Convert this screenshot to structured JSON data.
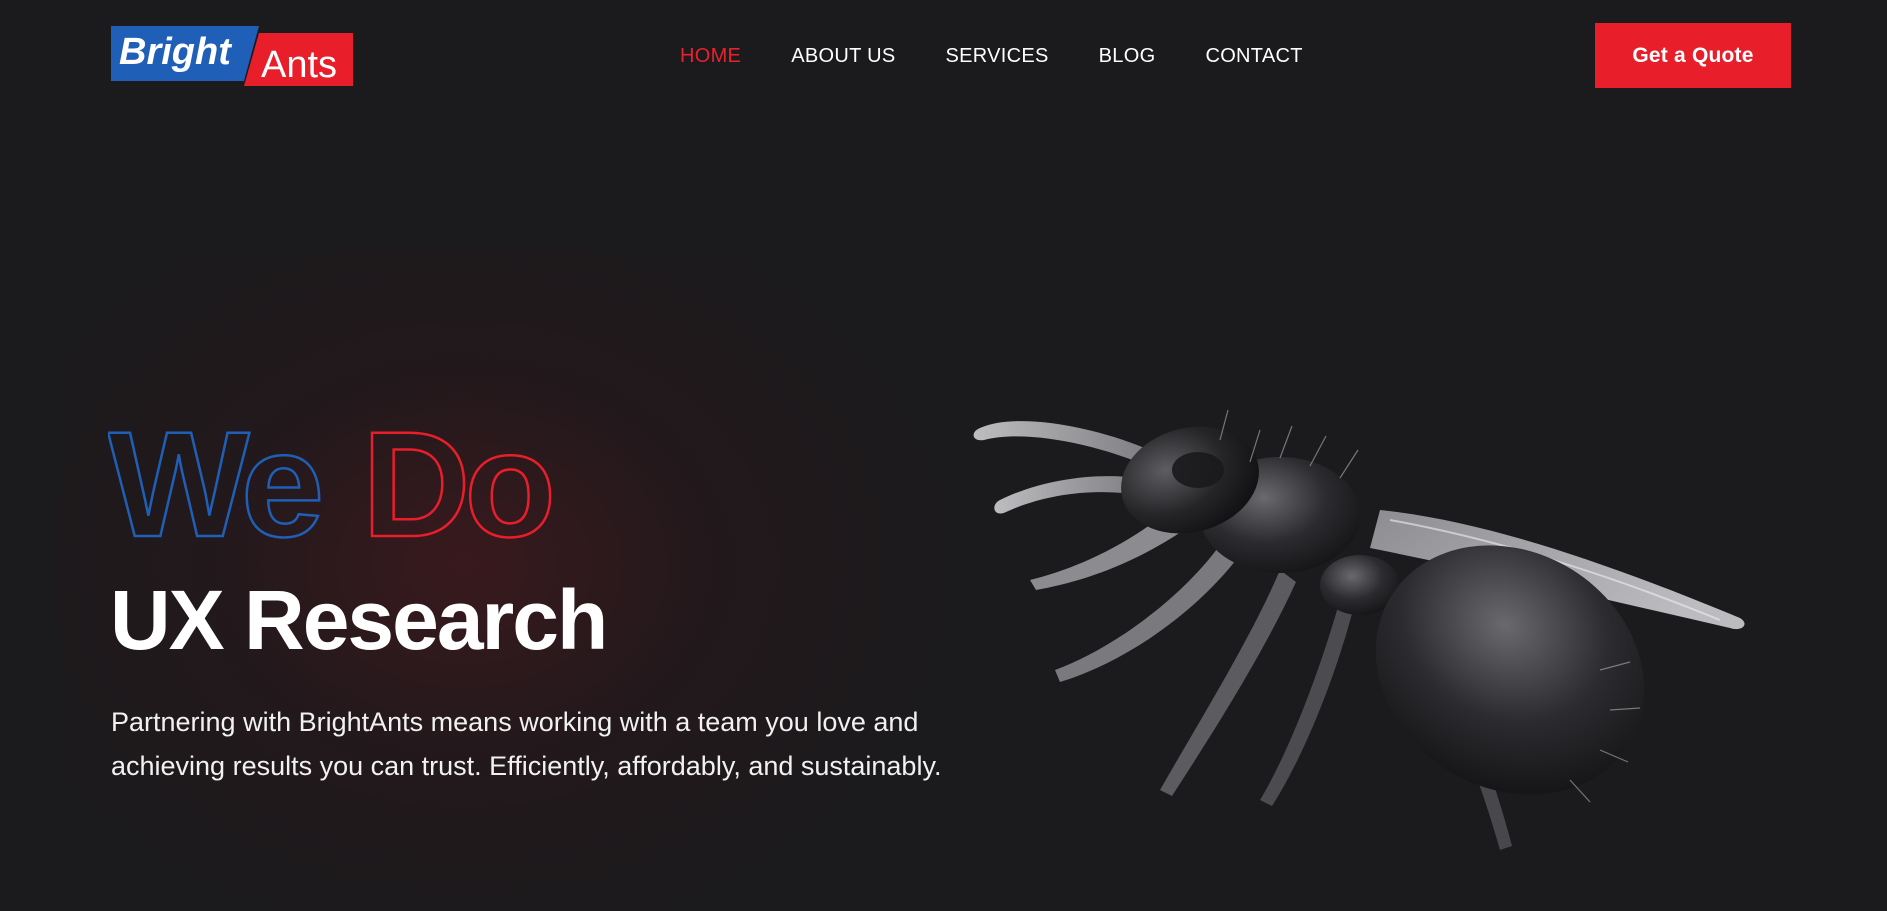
{
  "brand": {
    "logo_word_left": "Bright",
    "logo_word_right": "Ants",
    "blue": "#1f5fb8",
    "red": "#e81e2b"
  },
  "nav": {
    "items": [
      {
        "label": "HOME",
        "active": true
      },
      {
        "label": "ABOUT US",
        "active": false
      },
      {
        "label": "SERVICES",
        "active": false
      },
      {
        "label": "BLOG",
        "active": false
      },
      {
        "label": "CONTACT",
        "active": false
      }
    ],
    "active_color": "#e8212d"
  },
  "cta": {
    "label": "Get a Quote"
  },
  "hero": {
    "outline_word_1": "We",
    "outline_word_2": "Do",
    "title": "UX Research",
    "description": "Partnering with BrightAnts means working with a team you love and achieving results you can trust. Efficiently, affordably, and sustainably."
  },
  "images": {
    "hero_illustration": "winged-ant-image"
  }
}
